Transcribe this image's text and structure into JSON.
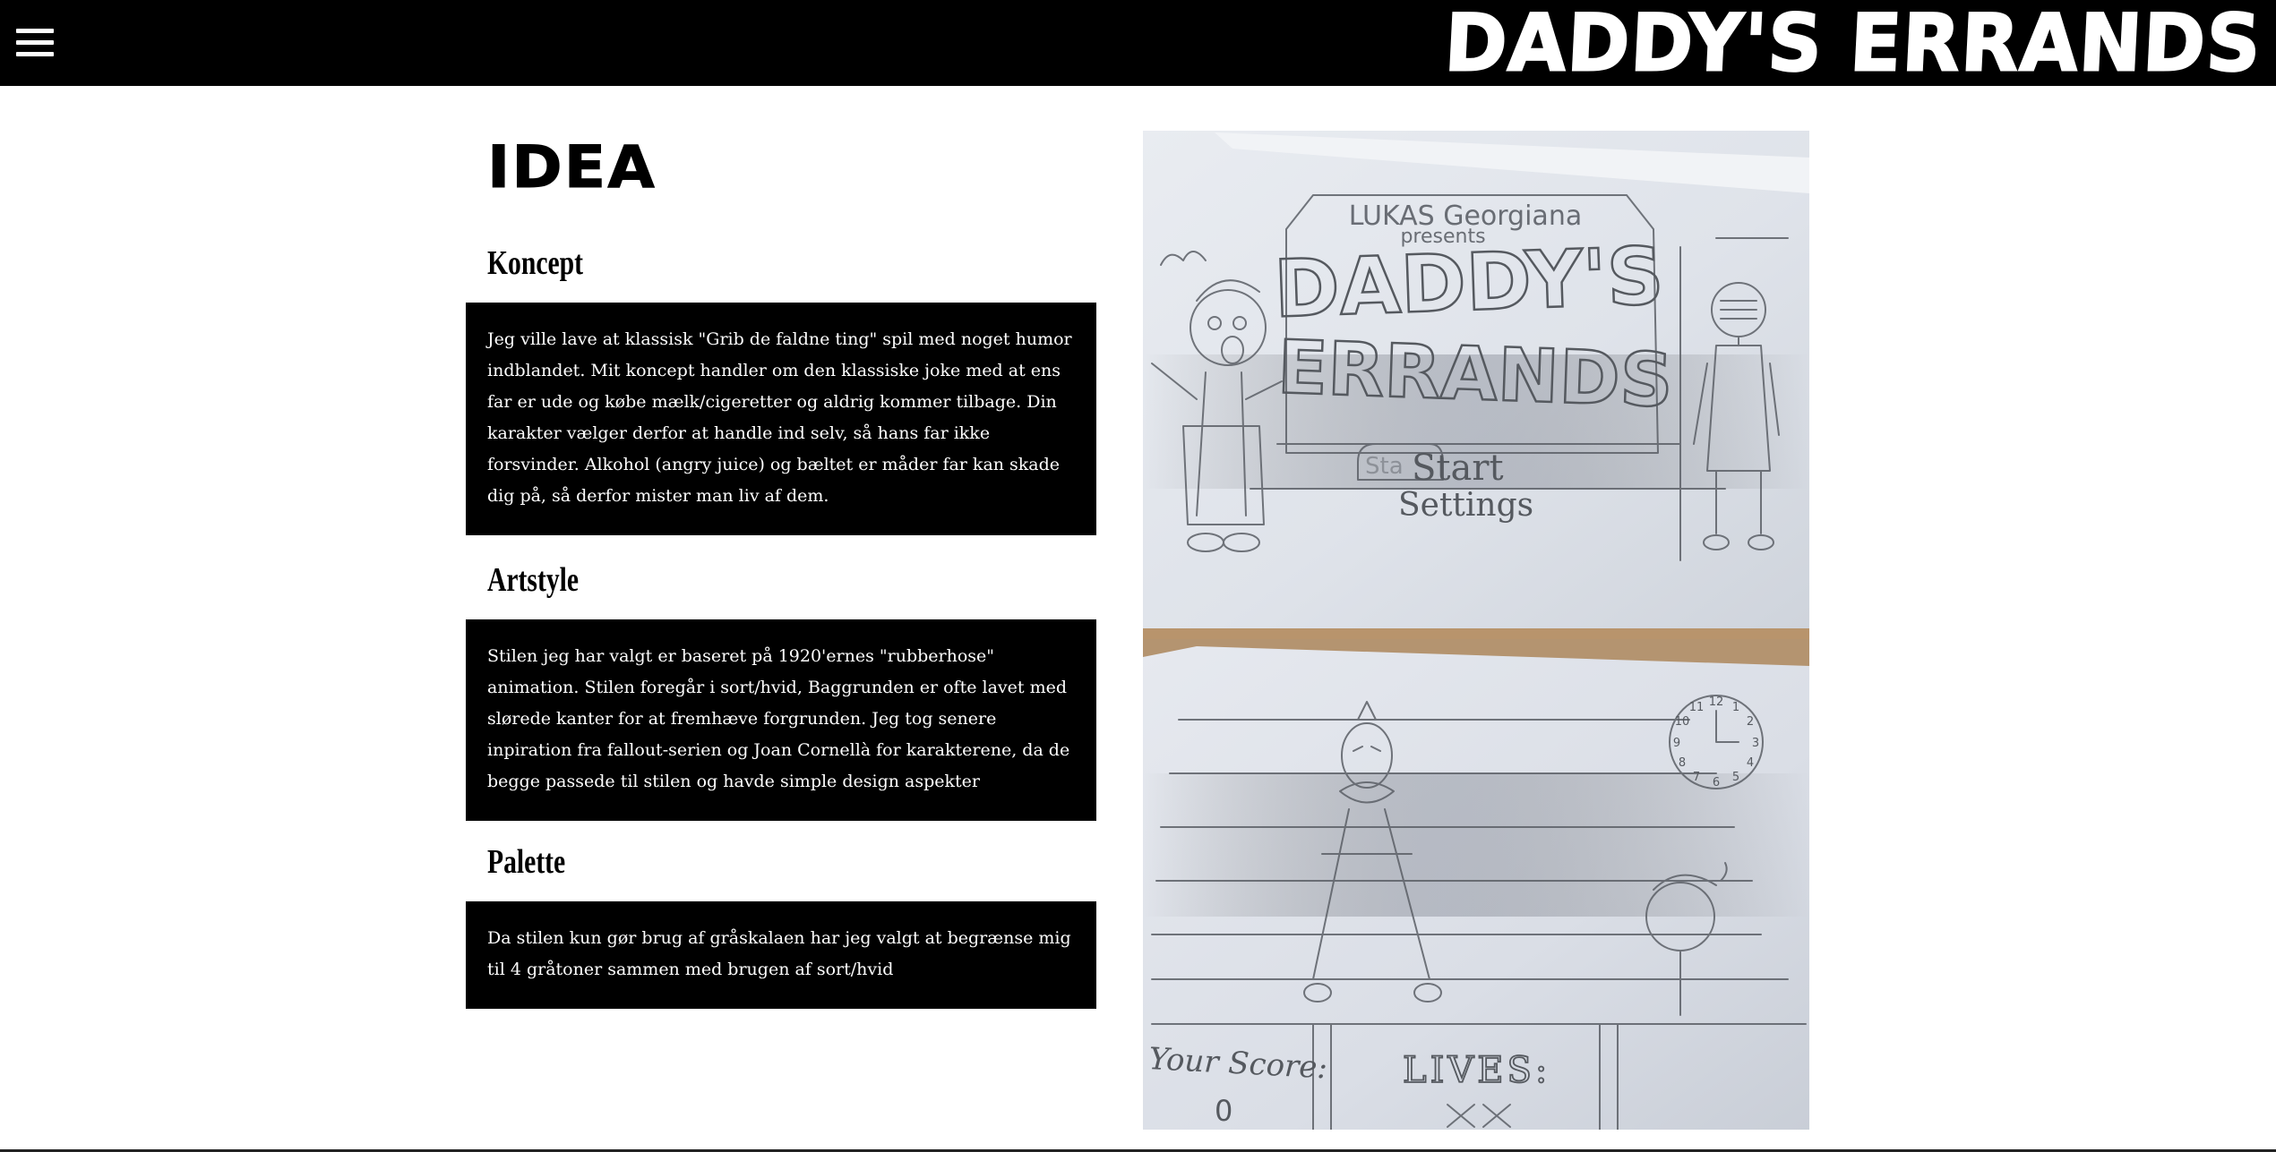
{
  "header": {
    "title": "DADDY'S ERRANDS",
    "menu_icon": "hamburger-menu-icon",
    "background": "#000000",
    "text_color": "#ffffff"
  },
  "main": {
    "title": "IDEA",
    "sections": [
      {
        "heading": "Koncept",
        "body": "Jeg ville lave at klassisk \"Grib de faldne ting\" spil med noget humor indblandet. Mit koncept handler om den klassiske joke med at ens far er ude og købe mælk/cigeretter og aldrig kommer tilbage. Din karakter vælger derfor at handle ind selv, så hans far ikke forsvinder. Alkohol (angry juice) og bæltet er måder far kan skade dig på, så derfor mister man liv af dem."
      },
      {
        "heading": "Artstyle",
        "body": "Stilen jeg har valgt er baseret på 1920'ernes \"rubberhose\" animation. Stilen foregår i sort/hvid, Baggrunden er ofte lavet med slørede kanter for at fremhæve forgrunden. Jeg tog senere inpiration fra fallout-serien og Joan Cornellà for karakterene, da de begge passede til stilen og havde simple design aspekter"
      },
      {
        "heading": "Palette",
        "body": "Da stilen kun gør brug af gråskalaen har jeg valgt at begrænse mig til 4 gråtoner sammen med brugen af sort/hvid"
      }
    ]
  },
  "sketches": {
    "title_screen": {
      "credit": "LUKAS Georgiana",
      "presents": "presents",
      "logo_line1": "DADDY'S",
      "logo_line2": "ERRANDS",
      "menu_start": "Start",
      "menu_settings": "Settings",
      "menu_scribble": "Sta"
    },
    "game_screen": {
      "score_label": "Your Score:",
      "score_value": "0",
      "lives_label": "LIVES:",
      "lives_value": "XX",
      "clock_numbers": [
        "12",
        "1",
        "2",
        "3",
        "4",
        "5",
        "6",
        "7",
        "8",
        "9",
        "10",
        "11"
      ]
    }
  }
}
